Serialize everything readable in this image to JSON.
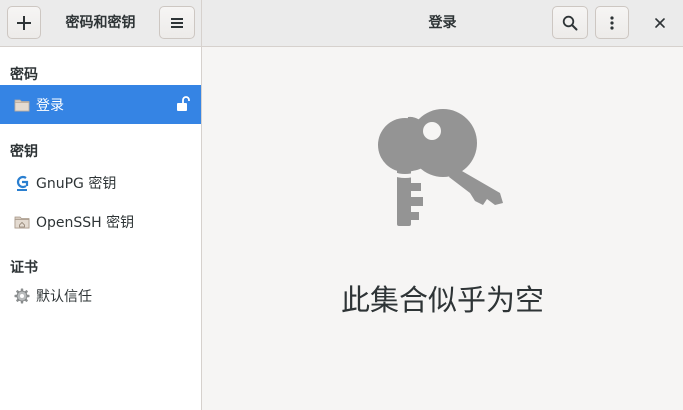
{
  "header": {
    "add_icon": "plus-icon",
    "title": "密码和密钥",
    "menu_icon": "hamburger-menu-icon",
    "page_title": "登录",
    "search_icon": "search-icon",
    "more_icon": "vertical-ellipsis-icon",
    "close_icon": "close-icon"
  },
  "sidebar": {
    "sections": [
      {
        "title": "密码"
      },
      {
        "title": "密钥"
      },
      {
        "title": "证书"
      }
    ],
    "items": [
      {
        "label": "登录",
        "icon": "folder-icon",
        "selected": true,
        "status_icon": "unlocked-padlock-icon"
      },
      {
        "label": "GnuPG 密钥",
        "icon": "gnupg-icon"
      },
      {
        "label": "OpenSSH 密钥",
        "icon": "folder-home-icon"
      },
      {
        "label": "默认信任",
        "icon": "gear-icon"
      }
    ]
  },
  "main": {
    "empty_icon": "keys-icon",
    "empty_message": "此集合似乎为空"
  },
  "colors": {
    "accent": "#3584e4",
    "headerbar": "#ebebeb",
    "main_bg": "#f6f5f4",
    "empty_icon": "#949494"
  }
}
